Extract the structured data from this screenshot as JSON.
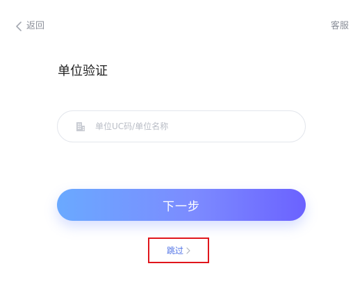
{
  "header": {
    "back_label": "返回",
    "back_icon": "chevron-left-icon",
    "service_label": "客服"
  },
  "main": {
    "title": "单位验证",
    "input": {
      "placeholder": "单位UC码/单位名称",
      "value": "",
      "icon": "building-icon"
    },
    "next_label": "下一步",
    "skip_label": "跳过",
    "skip_icon": "chevron-right-icon"
  },
  "colors": {
    "accent_start": "#6aa9ff",
    "accent_end": "#6b62ff",
    "link": "#4f72e6",
    "highlight_border": "#e0151b"
  }
}
